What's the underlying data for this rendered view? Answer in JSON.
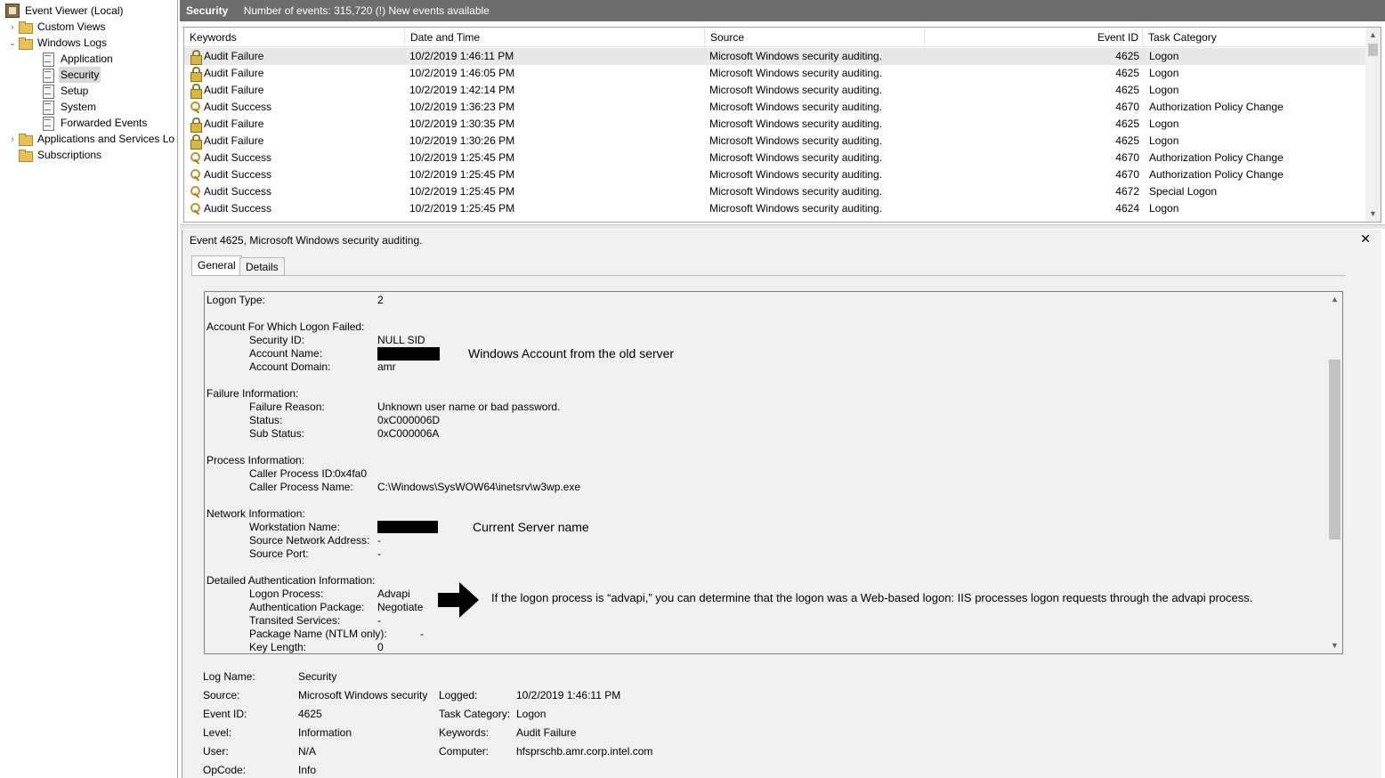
{
  "tree": {
    "root": "Event Viewer (Local)",
    "custom_views": "Custom Views",
    "windows_logs": "Windows Logs",
    "application": "Application",
    "security": "Security",
    "setup": "Setup",
    "system": "System",
    "forwarded_events": "Forwarded Events",
    "apps_services": "Applications and Services Lo",
    "subscriptions": "Subscriptions"
  },
  "header": {
    "title": "Security",
    "info": "Number of events: 315,720 (!) New events available"
  },
  "grid": {
    "columns": [
      "Keywords",
      "Date and Time",
      "Source",
      "Event ID",
      "Task Category"
    ],
    "rows": [
      {
        "icon": "lock-icon",
        "keyword": "Audit Failure",
        "date": "10/2/2019 1:46:11 PM",
        "source": "Microsoft Windows security auditing.",
        "event_id": "4625",
        "category": "Logon"
      },
      {
        "icon": "lock-icon",
        "keyword": "Audit Failure",
        "date": "10/2/2019 1:46:05 PM",
        "source": "Microsoft Windows security auditing.",
        "event_id": "4625",
        "category": "Logon"
      },
      {
        "icon": "lock-icon",
        "keyword": "Audit Failure",
        "date": "10/2/2019 1:42:14 PM",
        "source": "Microsoft Windows security auditing.",
        "event_id": "4625",
        "category": "Logon"
      },
      {
        "icon": "key-icon",
        "keyword": "Audit Success",
        "date": "10/2/2019 1:36:23 PM",
        "source": "Microsoft Windows security auditing.",
        "event_id": "4670",
        "category": "Authorization Policy Change"
      },
      {
        "icon": "lock-icon",
        "keyword": "Audit Failure",
        "date": "10/2/2019 1:30:35 PM",
        "source": "Microsoft Windows security auditing.",
        "event_id": "4625",
        "category": "Logon"
      },
      {
        "icon": "lock-icon",
        "keyword": "Audit Failure",
        "date": "10/2/2019 1:30:26 PM",
        "source": "Microsoft Windows security auditing.",
        "event_id": "4625",
        "category": "Logon"
      },
      {
        "icon": "key-icon",
        "keyword": "Audit Success",
        "date": "10/2/2019 1:25:45 PM",
        "source": "Microsoft Windows security auditing.",
        "event_id": "4670",
        "category": "Authorization Policy Change"
      },
      {
        "icon": "key-icon",
        "keyword": "Audit Success",
        "date": "10/2/2019 1:25:45 PM",
        "source": "Microsoft Windows security auditing.",
        "event_id": "4670",
        "category": "Authorization Policy Change"
      },
      {
        "icon": "key-icon",
        "keyword": "Audit Success",
        "date": "10/2/2019 1:25:45 PM",
        "source": "Microsoft Windows security auditing.",
        "event_id": "4672",
        "category": "Special Logon"
      },
      {
        "icon": "key-icon",
        "keyword": "Audit Success",
        "date": "10/2/2019 1:25:45 PM",
        "source": "Microsoft Windows security auditing.",
        "event_id": "4624",
        "category": "Logon"
      }
    ]
  },
  "detail": {
    "title": "Event 4625, Microsoft Windows security auditing.",
    "close": "✕",
    "tabs": {
      "general": "General",
      "details": "Details"
    },
    "message": {
      "logon_type_label": "Logon Type:",
      "logon_type_value": "2",
      "account_section": "Account For Which Logon Failed:",
      "security_id_label": "Security ID:",
      "security_id_value": "NULL SID",
      "account_name_label": "Account Name:",
      "account_domain_label": "Account Domain:",
      "account_domain_value": "amr",
      "failure_section": "Failure Information:",
      "failure_reason_label": "Failure Reason:",
      "failure_reason_value": "Unknown user name or bad password.",
      "status_label": "Status:",
      "status_value": "0xC000006D",
      "sub_status_label": "Sub Status:",
      "sub_status_value": "0xC000006A",
      "process_section": "Process Information:",
      "caller_pid_label": "Caller Process ID:",
      "caller_pid_value": "0x4fa0",
      "caller_pname_label": "Caller Process Name:",
      "caller_pname_value": "C:\\Windows\\SysWOW64\\inetsrv\\w3wp.exe",
      "network_section": "Network Information:",
      "workstation_label": "Workstation Name:",
      "src_addr_label": "Source Network Address:",
      "src_addr_value": "-",
      "src_port_label": "Source Port:",
      "src_port_value": "-",
      "auth_section": "Detailed Authentication Information:",
      "logon_process_label": "Logon Process:",
      "logon_process_value": "Advapi",
      "auth_package_label": "Authentication Package:",
      "auth_package_value": "Negotiate",
      "transited_label": "Transited Services:",
      "transited_value": "-",
      "package_name_label": "Package Name (NTLM only):",
      "package_name_value": "-",
      "key_length_label": "Key Length:",
      "key_length_value": "0"
    },
    "annotations": {
      "account_note": "Windows Account from the old server",
      "server_note": "Current Server name",
      "advapi_note": "If the logon process is “advapi,” you can determine that the logon was a Web-based logon: IIS processes logon requests through the advapi process."
    },
    "props": {
      "log_name_label": "Log Name:",
      "log_name_value": "Security",
      "source_label": "Source:",
      "source_value": "Microsoft Windows security",
      "logged_label": "Logged:",
      "logged_value": "10/2/2019 1:46:11 PM",
      "event_id_label": "Event ID:",
      "event_id_value": "4625",
      "task_cat_label": "Task Category:",
      "task_cat_value": "Logon",
      "level_label": "Level:",
      "level_value": "Information",
      "keywords_label": "Keywords:",
      "keywords_value": "Audit Failure",
      "user_label": "User:",
      "user_value": "N/A",
      "computer_label": "Computer:",
      "computer_value": "hfsprschb.amr.corp.intel.com",
      "opcode_label": "OpCode:",
      "opcode_value": "Info"
    }
  }
}
